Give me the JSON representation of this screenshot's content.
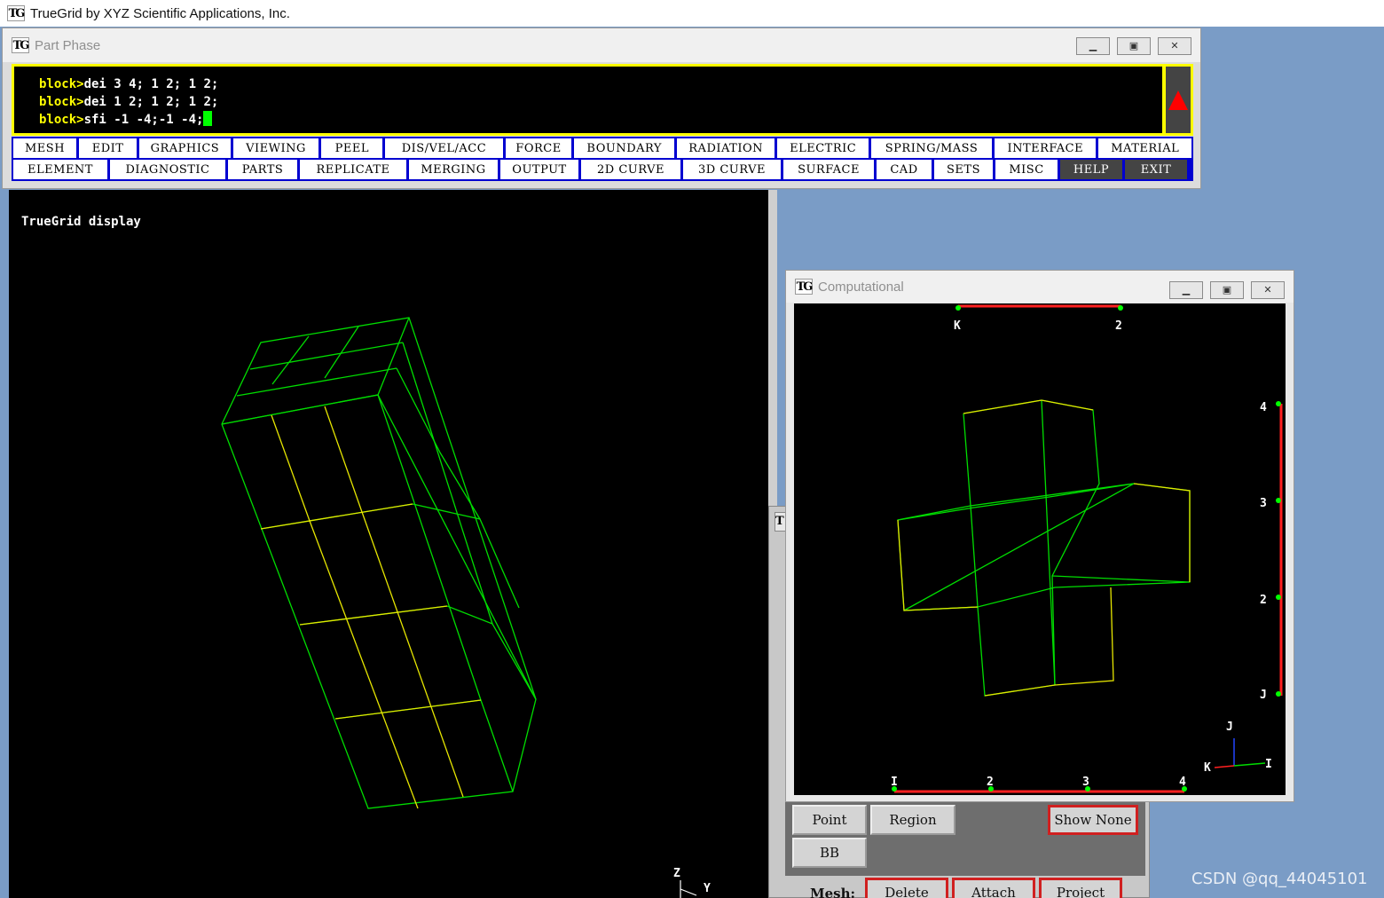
{
  "app": {
    "logo": "TG",
    "title": "TrueGrid by XYZ Scientific Applications, Inc."
  },
  "part_phase": {
    "title": "Part Phase",
    "commands": [
      {
        "prompt": "block>",
        "text": "dei 3 4; 1 2; 1 2;"
      },
      {
        "prompt": "block>",
        "text": "dei 1 2; 1 2; 1 2;"
      },
      {
        "prompt": "block>",
        "text": "sfi -1 -4;-1 -4;"
      }
    ],
    "menu_row1": [
      "MESH",
      "EDIT",
      "GRAPHICS",
      "VIEWING",
      "PEEL",
      "DIS/VEL/ACC",
      "FORCE",
      "BOUNDARY",
      "RADIATION",
      "ELECTRIC",
      "SPRING/MASS",
      "INTERFACE",
      "MATERIAL"
    ],
    "menu_row2": [
      "ELEMENT",
      "DIAGNOSTIC",
      "PARTS",
      "REPLICATE",
      "MERGING",
      "OUTPUT",
      "2D CURVE",
      "3D CURVE",
      "SURFACE",
      "CAD",
      "SETS",
      "MISC",
      "HELP",
      "EXIT"
    ]
  },
  "display": {
    "label": "TrueGrid display",
    "axes": {
      "z": "Z",
      "y": "Y"
    },
    "colors": {
      "mesh": "#00dd00",
      "highlight": "#e6e600"
    }
  },
  "computational": {
    "title": "Computational",
    "k_labels": [
      "K",
      "2"
    ],
    "j_labels": [
      "4",
      "3",
      "2",
      "J"
    ],
    "i_labels": [
      "I",
      "2",
      "3",
      "4"
    ],
    "triad": {
      "j": "J",
      "k": "K",
      "i": "I"
    }
  },
  "panel": {
    "buttons": {
      "point": "Point",
      "region": "Region",
      "show_none": "Show None",
      "bb": "BB"
    },
    "mesh_label": "Mesh:",
    "mesh_buttons": {
      "delete": "Delete",
      "attach": "Attach",
      "project": "Project"
    }
  },
  "watermark": "CSDN @qq_44045101"
}
